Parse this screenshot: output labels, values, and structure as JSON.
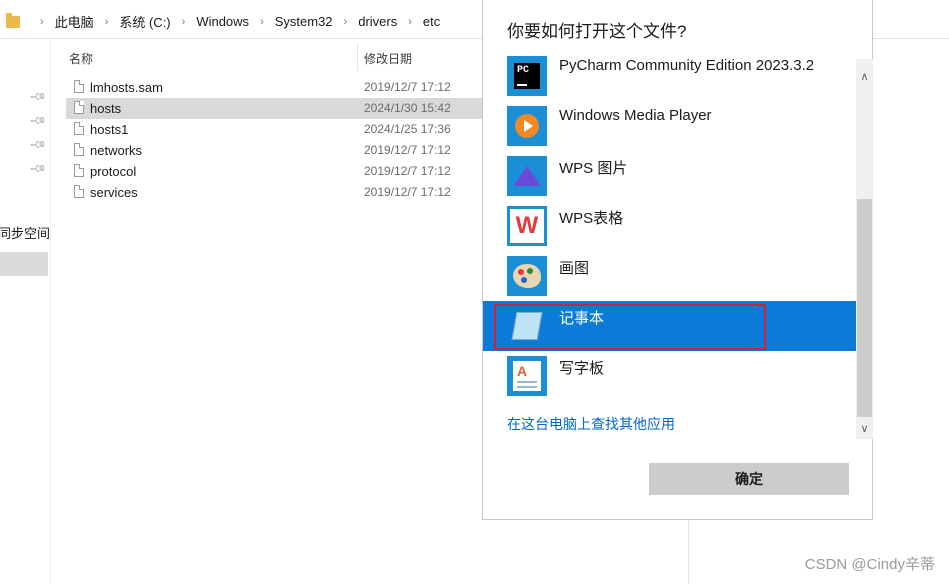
{
  "explorer": {
    "breadcrumb": [
      "此电脑",
      "系统 (C:)",
      "Windows",
      "System32",
      "drivers",
      "etc"
    ],
    "columns": {
      "name": "名称",
      "modified": "修改日期"
    },
    "left_pane_label": "同步空间",
    "files": [
      {
        "name": "lmhosts.sam",
        "date": "2019/12/7 17:12",
        "selected": false
      },
      {
        "name": "hosts",
        "date": "2024/1/30 15:42",
        "selected": true
      },
      {
        "name": "hosts1",
        "date": "2024/1/25 17:36",
        "selected": false
      },
      {
        "name": "networks",
        "date": "2019/12/7 17:12",
        "selected": false
      },
      {
        "name": "protocol",
        "date": "2019/12/7 17:12",
        "selected": false
      },
      {
        "name": "services",
        "date": "2019/12/7 17:12",
        "selected": false
      }
    ]
  },
  "dialog": {
    "title": "你要如何打开这个文件?",
    "apps": [
      {
        "label": "PyCharm Community Edition 2023.3.2",
        "icon": "pycharm-icon",
        "selected": false
      },
      {
        "label": "Windows Media Player",
        "icon": "media-player-icon",
        "selected": false
      },
      {
        "label": "WPS 图片",
        "icon": "wps-picture-icon",
        "selected": false
      },
      {
        "label": "WPS表格",
        "icon": "wps-spreadsheet-icon",
        "selected": false
      },
      {
        "label": "画图",
        "icon": "paint-icon",
        "selected": false
      },
      {
        "label": "记事本",
        "icon": "notepad-icon",
        "selected": true
      },
      {
        "label": "写字板",
        "icon": "wordpad-icon",
        "selected": false
      }
    ],
    "more_apps_link": "在这台电脑上查找其他应用",
    "ok_button": "确定",
    "highlight_color": "#d0213a",
    "selection_color": "#0c7ad6"
  },
  "watermark": "CSDN @Cindy辛蒂",
  "icons": {
    "pxcharm_text": "PC",
    "wps_sheet_letter": "W",
    "wordpad_letter": "A"
  }
}
